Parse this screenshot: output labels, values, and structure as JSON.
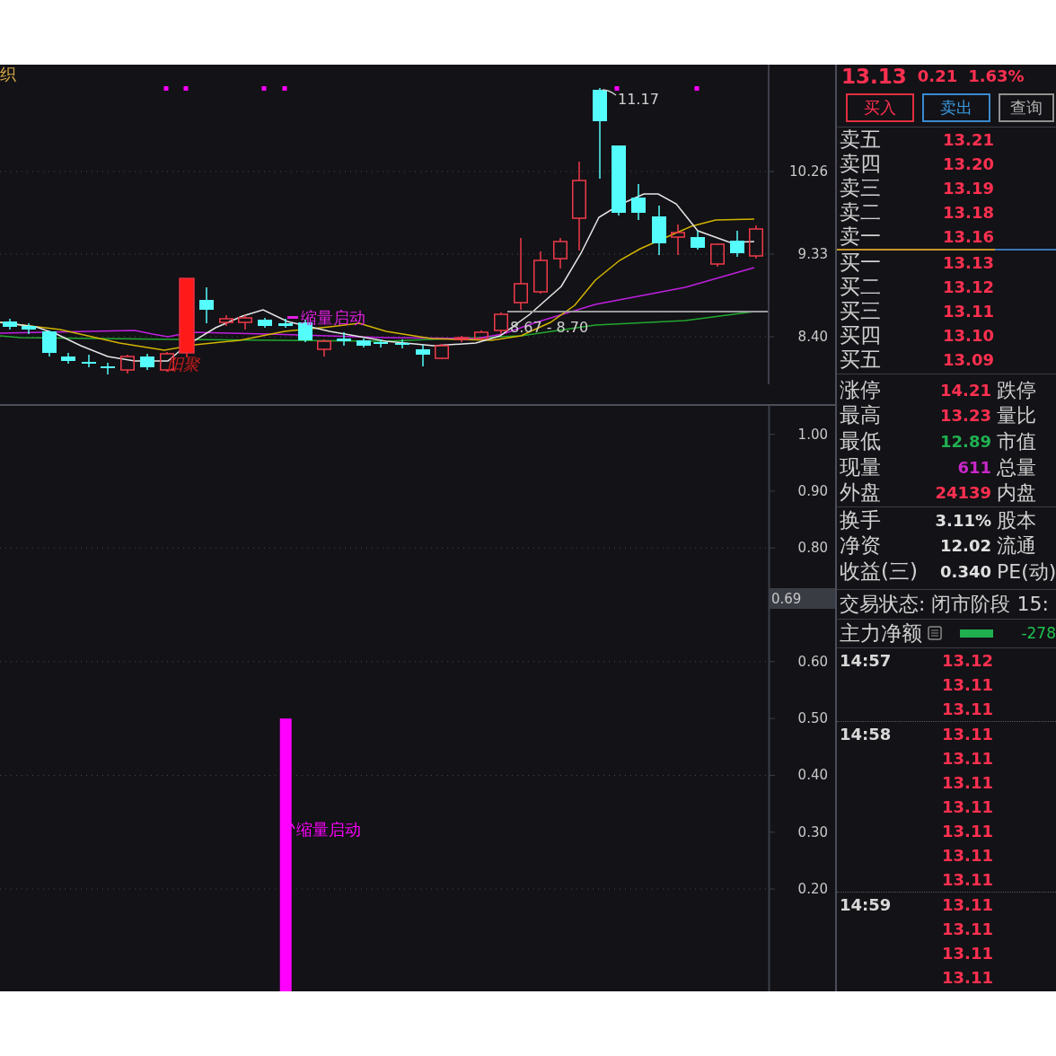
{
  "price_chart": {
    "title": "织",
    "axis_labels": [
      "10.26",
      "9.33",
      "8.40"
    ],
    "high_label": "11.17",
    "range_label": "8.67 - 8.70",
    "signals": [
      {
        "kind": "shrink",
        "text": "缩量启动",
        "color": "#e020e0"
      },
      {
        "kind": "gather",
        "text": "阳聚",
        "color": "#c41c1c"
      }
    ]
  },
  "indicator_chart": {
    "chart_data": {
      "type": "bar",
      "values": [
        null,
        null,
        null,
        null,
        null,
        null,
        null,
        null,
        null,
        null,
        null,
        null,
        null,
        null,
        0.5,
        null,
        null,
        null,
        null,
        null,
        null,
        null,
        null,
        null,
        null,
        null,
        null,
        null,
        null,
        null,
        null,
        null,
        null,
        null,
        null,
        null,
        null,
        null,
        null
      ],
      "ylim": [
        0.02,
        1.05
      ],
      "yticks": [
        {
          "value": 1.0,
          "label": "1.00"
        },
        {
          "value": 0.9,
          "label": "0.90"
        },
        {
          "value": 0.8,
          "label": "0.80"
        },
        {
          "value": 0.6,
          "label": "0.60"
        },
        {
          "value": 0.5,
          "label": "0.50"
        },
        {
          "value": 0.4,
          "label": "0.40"
        },
        {
          "value": 0.3,
          "label": "0.30"
        },
        {
          "value": 0.2,
          "label": "0.20"
        }
      ],
      "grid": true
    },
    "current_value": "0.69",
    "signal": "缩量启动"
  },
  "quote": {
    "price": "13.13",
    "change": "0.21",
    "change_pct": "1.63%"
  },
  "buttons": [
    {
      "label": "买入",
      "kind": "buy"
    },
    {
      "label": "卖出",
      "kind": "sell"
    },
    {
      "label": "查询",
      "kind": "query"
    }
  ],
  "order_book": {
    "asks": [
      {
        "label": "卖五",
        "price": "13.21"
      },
      {
        "label": "卖四",
        "price": "13.20"
      },
      {
        "label": "卖三",
        "price": "13.19"
      },
      {
        "label": "卖二",
        "price": "13.18"
      },
      {
        "label": "卖一",
        "price": "13.16"
      }
    ],
    "ratio_bar": {
      "level": 0.72
    },
    "bids": [
      {
        "label": "买一",
        "price": "13.13"
      },
      {
        "label": "买二",
        "price": "13.12"
      },
      {
        "label": "买三",
        "price": "13.11"
      },
      {
        "label": "买四",
        "price": "13.10"
      },
      {
        "label": "买五",
        "price": "13.09"
      }
    ]
  },
  "stats": [
    {
      "label": "涨停",
      "value": "14.21",
      "color": "#ff3050",
      "label_2": "跌停"
    },
    {
      "label": "最高",
      "value": "13.23",
      "color": "#ff3050",
      "label_2": "量比"
    },
    {
      "label": "最低",
      "value": "12.89",
      "color": "#20b050",
      "label_2": "市值"
    },
    {
      "label": "现量",
      "value": "611",
      "color": "#c828c8",
      "label_2": "总量"
    },
    {
      "label": "外盘",
      "value": "24139",
      "color": "#ff3050",
      "label_2": "内盘"
    }
  ],
  "fundamentals": [
    {
      "label": "换手",
      "value": "3.11%",
      "label_2": "股本"
    },
    {
      "label": "净资",
      "value": "12.02",
      "label_2": "流通"
    },
    {
      "label": "收益(三)",
      "value": "0.340",
      "label_2": "PE(动)"
    }
  ],
  "trading_status": "交易状态: 闭市阶段 15:",
  "main_net": {
    "label": "主力净额",
    "value": "-278"
  },
  "ticks": [
    {
      "time": "14:57",
      "prices": [
        "13.12",
        "13.11",
        "13.11"
      ]
    },
    {
      "time": "14:58",
      "prices": [
        "13.11",
        "13.11",
        "13.11",
        "13.11",
        "13.11",
        "13.11",
        "13.11"
      ]
    },
    {
      "time": "14:59",
      "prices": [
        "13.11",
        "13.11",
        "13.11",
        "13.11"
      ]
    }
  ]
}
